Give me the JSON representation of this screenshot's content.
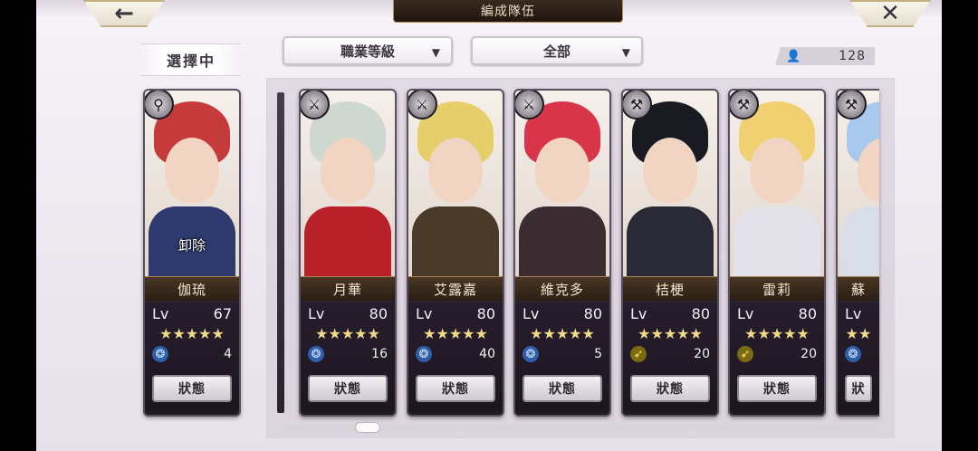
{
  "header": {
    "back_icon": "←",
    "title": "編成隊伍",
    "close_icon": "✕"
  },
  "selected": {
    "label": "選擇中",
    "card": {
      "name": "伽琉",
      "lv_label": "Lv",
      "lv": "67",
      "stars": "★★★★★",
      "element": "water",
      "element_icon": "❂",
      "count": "4",
      "status_label": "狀態",
      "release_label": "卸除",
      "class_icon": "⚲",
      "hair": "#c53a3a",
      "body": "#2e3a6e"
    }
  },
  "filters": {
    "class_filter": "職業等級",
    "scope_filter": "全部",
    "arrow": "▼"
  },
  "unit_count": {
    "icon": "👤",
    "value": "128"
  },
  "roster": [
    {
      "name": "月華",
      "lv_label": "Lv",
      "lv": "80",
      "stars": "★★★★★",
      "element": "water",
      "element_icon": "❂",
      "count": "16",
      "status_label": "狀態",
      "class_icon": "⚔",
      "hair": "#cfd8d0",
      "body": "#b8212a"
    },
    {
      "name": "艾露嘉",
      "lv_label": "Lv",
      "lv": "80",
      "stars": "★★★★★",
      "element": "water",
      "element_icon": "❂",
      "count": "40",
      "status_label": "狀態",
      "class_icon": "⚔",
      "hair": "#e6cf6a",
      "body": "#4a3a2a"
    },
    {
      "name": "維克多",
      "lv_label": "Lv",
      "lv": "80",
      "stars": "★★★★★",
      "element": "water",
      "element_icon": "❂",
      "count": "5",
      "status_label": "狀態",
      "class_icon": "⚔",
      "hair": "#d8344a",
      "body": "#3a2c30"
    },
    {
      "name": "桔梗",
      "lv_label": "Lv",
      "lv": "80",
      "stars": "★★★★★",
      "element": "wind",
      "element_icon": "➶",
      "count": "20",
      "status_label": "狀態",
      "class_icon": "⚒",
      "hair": "#1a1a22",
      "body": "#2a2a36"
    },
    {
      "name": "雷莉",
      "lv_label": "Lv",
      "lv": "80",
      "stars": "★★★★★",
      "element": "wind",
      "element_icon": "➶",
      "count": "20",
      "status_label": "狀態",
      "class_icon": "⚒",
      "hair": "#f0d070",
      "body": "#e2e2e8"
    },
    {
      "name": "蘇",
      "lv_label": "Lv",
      "lv": "",
      "stars": "★★",
      "element": "water",
      "element_icon": "❂",
      "count": "",
      "status_label": "狀",
      "class_icon": "⚒",
      "hair": "#a9c8ee",
      "body": "#d9dde8"
    }
  ]
}
